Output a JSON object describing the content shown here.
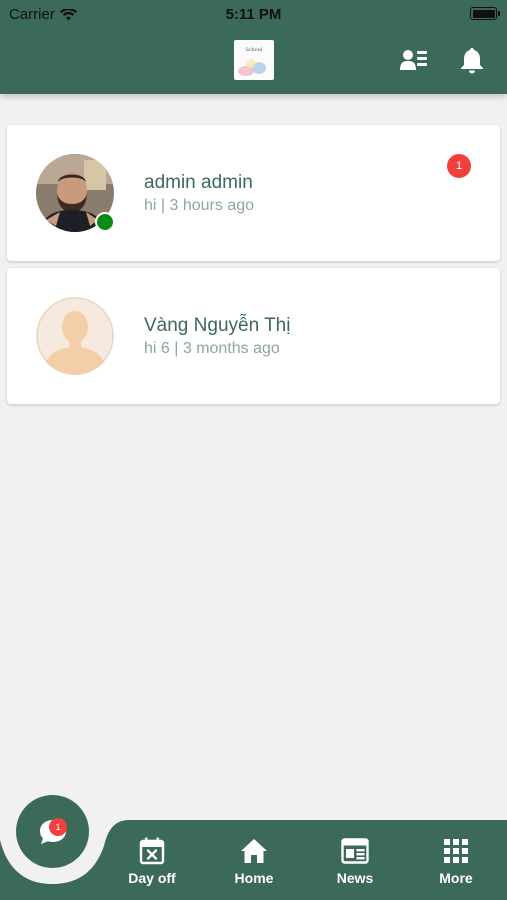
{
  "status_bar": {
    "carrier": "Carrier",
    "time": "5:11 PM"
  },
  "header": {
    "logo_text": "School"
  },
  "conversations": [
    {
      "name": "admin admin",
      "last_message": "hi | 3 hours ago",
      "unread_count": "1",
      "online": true
    },
    {
      "name": "Vàng Nguyễn Thị",
      "last_message": "hi 6 | 3 months ago",
      "online": false
    }
  ],
  "chat_button": {
    "badge": "1"
  },
  "tabs": [
    {
      "label": "Day off",
      "icon": "calendar-x-icon"
    },
    {
      "label": "Home",
      "icon": "home-icon"
    },
    {
      "label": "News",
      "icon": "news-icon"
    },
    {
      "label": "More",
      "icon": "grid-icon"
    }
  ],
  "colors": {
    "primary": "#3c6a58",
    "badge": "#f1403d",
    "online": "#0c8a17",
    "background": "#f1f1f1"
  }
}
